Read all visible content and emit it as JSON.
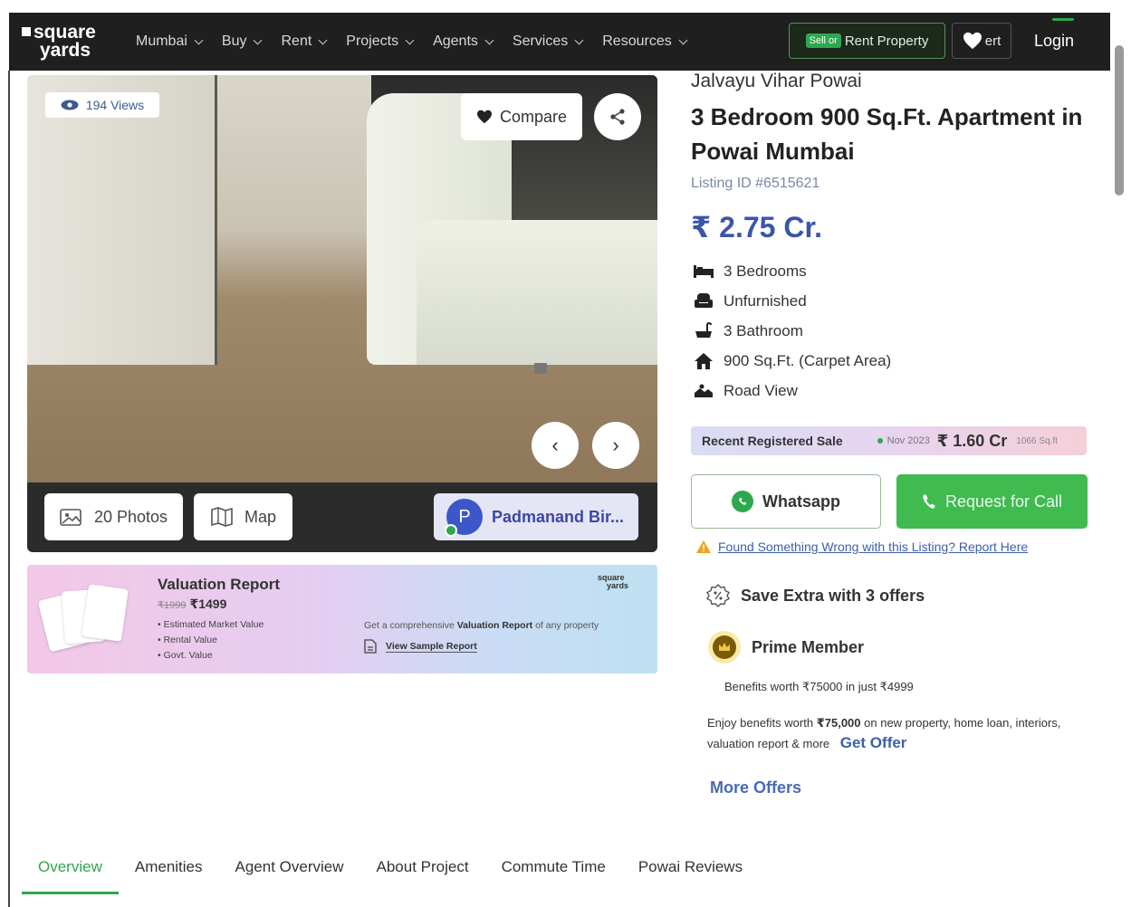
{
  "nav": {
    "logo_line1": "square",
    "logo_line2": "yards",
    "items": [
      {
        "label": "Mumbai"
      },
      {
        "label": "Buy"
      },
      {
        "label": "Rent"
      },
      {
        "label": "Projects"
      },
      {
        "label": "Agents"
      },
      {
        "label": "Services"
      },
      {
        "label": "Resources"
      }
    ],
    "sell_badge": "Sell or",
    "sell_label": "Rent Property",
    "shortlist_label": "ert",
    "login_label": "Login"
  },
  "gallery": {
    "views": "194 Views",
    "compare_label": "Compare",
    "photos_label": "20 Photos",
    "map_label": "Map",
    "agent_initial": "P",
    "agent_name": "Padmanand Bir..."
  },
  "valuation": {
    "title": "Valuation Report",
    "old_price": "₹1999",
    "price": "₹1499",
    "points": [
      "Estimated Market Value",
      "Rental Value",
      "Govt. Value"
    ],
    "brand_line1": "square",
    "brand_line2": "yards",
    "desc_prefix": "Get a comprehensive",
    "desc_bold": "Valuation Report",
    "desc_suffix": "of any property",
    "sample_label": "View Sample Report"
  },
  "listing": {
    "project_name": "Jalvayu Vihar Powai",
    "title": "3 Bedroom 900 Sq.Ft. Apartment in Powai Mumbai",
    "listing_id": "Listing ID #6515621",
    "price": "₹ 2.75 Cr.",
    "features": [
      {
        "icon": "bed-icon",
        "label": "3 Bedrooms"
      },
      {
        "icon": "armchair-icon",
        "label": "Unfurnished"
      },
      {
        "icon": "bathtub-icon",
        "label": "3 Bathroom"
      },
      {
        "icon": "home-icon",
        "label": "900 Sq.Ft. (Carpet Area)"
      },
      {
        "icon": "view-icon",
        "label": "Road View"
      }
    ]
  },
  "recent_sale": {
    "label": "Recent Registered Sale",
    "date": "Nov 2023",
    "amount": "₹ 1.60 Cr",
    "area": "1066 Sq.ft"
  },
  "actions": {
    "whatsapp_label": "Whatsapp",
    "call_label": "Request for Call",
    "report_text": "Found Something Wrong with this Listing? Report Here"
  },
  "offers": {
    "title": "Save Extra with 3 offers",
    "prime_label": "Prime Member",
    "benefits": "Benefits worth ₹75000 in just ₹4999",
    "enjoy_prefix": "Enjoy benefits worth",
    "enjoy_amount": "₹75,000",
    "enjoy_suffix": "on new property, home loan, interiors, valuation report & more",
    "get_offer": "Get Offer",
    "more_offers": "More Offers"
  },
  "tabs": [
    {
      "label": "Overview",
      "active": true
    },
    {
      "label": "Amenities"
    },
    {
      "label": "Agent Overview"
    },
    {
      "label": "About Project"
    },
    {
      "label": "Commute Time"
    },
    {
      "label": "Powai Reviews"
    }
  ],
  "colors": {
    "accent_green": "#2ea84e",
    "price_blue": "#3b56a8",
    "nav_bg": "#1f1f1f"
  }
}
